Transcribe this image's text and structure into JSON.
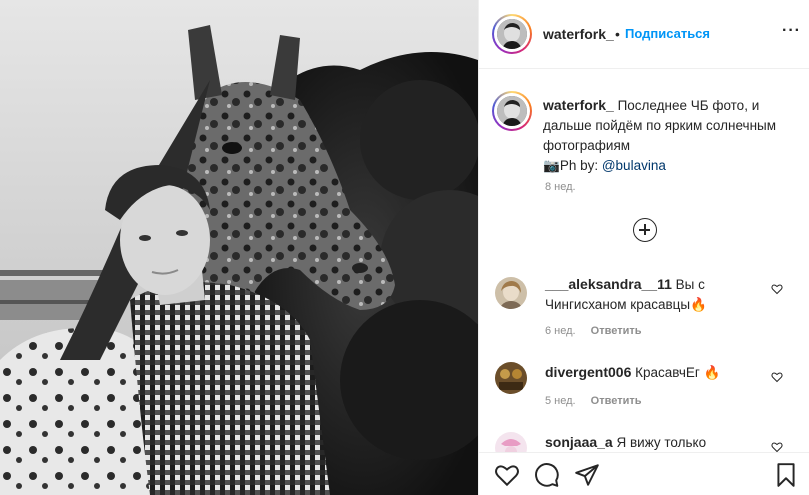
{
  "post": {
    "username": "waterfork_",
    "follow_separator": "•",
    "follow_label": "Подписаться",
    "more_label": "···",
    "caption_author": "waterfork_",
    "caption_body": "Последнее ЧБ фото, и дальше пойдём по ярким солнечным фотографиям",
    "caption_camera": "📷",
    "caption_credit_prefix": "Ph by: ",
    "caption_mention": "@bulavina",
    "caption_time": "8 нед."
  },
  "comments": [
    {
      "username": "___aleksandra__11",
      "text": "Вы с Чингисханом красавцы🔥",
      "time": "6 нед.",
      "reply_label": "Ответить"
    },
    {
      "username": "divergent006",
      "text": "КрасавчЕг 🔥",
      "time": "5 нед.",
      "reply_label": "Ответить"
    },
    {
      "username": "sonjaaa_a",
      "text": "Я вижу только",
      "time": "",
      "reply_label": ""
    }
  ],
  "icons": {
    "more": "more-options-icon",
    "load_more": "plus-circle-icon",
    "like": "heart-icon",
    "comment": "comment-icon",
    "share": "share-icon",
    "save": "bookmark-icon"
  },
  "colors": {
    "link": "#0095f6",
    "mention": "#00376b",
    "muted": "#8e8e8e",
    "text": "#262626"
  }
}
